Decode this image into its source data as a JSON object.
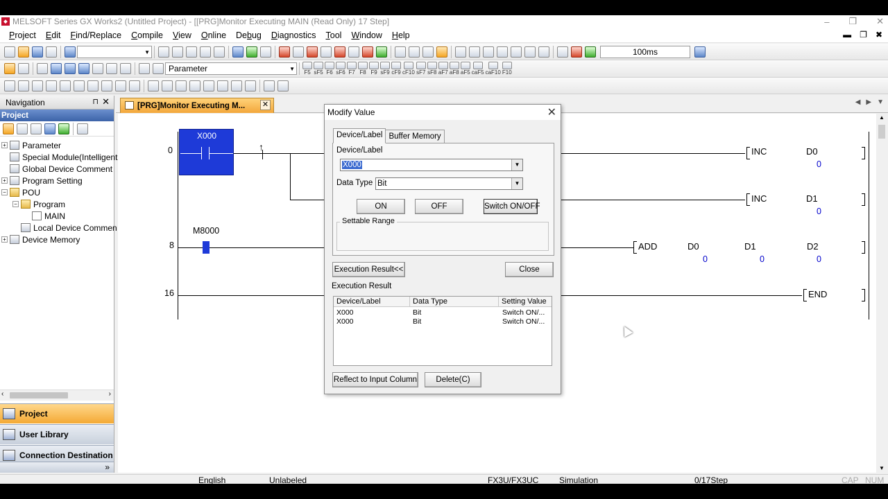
{
  "window": {
    "title": "MELSOFT Series GX Works2 (Untitled Project) - [[PRG]Monitor Executing MAIN (Read Only) 17 Step]",
    "app_icon": "mitsubishi-logo-icon"
  },
  "menu": {
    "items": [
      {
        "pre": "",
        "u": "P",
        "post": "roject"
      },
      {
        "pre": "",
        "u": "E",
        "post": "dit"
      },
      {
        "pre": "",
        "u": "F",
        "post": "ind/Replace"
      },
      {
        "pre": "",
        "u": "C",
        "post": "ompile"
      },
      {
        "pre": "",
        "u": "V",
        "post": "iew"
      },
      {
        "pre": "",
        "u": "O",
        "post": "nline"
      },
      {
        "pre": "De",
        "u": "b",
        "post": "ug"
      },
      {
        "pre": "",
        "u": "D",
        "post": "iagnostics"
      },
      {
        "pre": "",
        "u": "T",
        "post": "ool"
      },
      {
        "pre": "",
        "u": "W",
        "post": "indow"
      },
      {
        "pre": "",
        "u": "H",
        "post": "elp"
      }
    ]
  },
  "toolbar": {
    "parameter_combo": "Parameter",
    "speed": "100ms",
    "fkeys": [
      "F5",
      "sF5",
      "F6",
      "sF6",
      "F7",
      "F8",
      "F9",
      "sF9",
      "cF9",
      "cF10",
      "sF7",
      "sF8",
      "aF7",
      "aF8",
      "aF5",
      "caF5",
      "caF10",
      "F10"
    ]
  },
  "navigation": {
    "header": "Navigation",
    "pin": "⊓",
    "close": "✕",
    "section": "Project",
    "tree": [
      {
        "label": "Parameter",
        "indent": 0,
        "expander": "+",
        "icon": "gear"
      },
      {
        "label": "Special Module(Intelligent",
        "indent": 0,
        "expander": "",
        "icon": "module"
      },
      {
        "label": "Global Device Comment",
        "indent": 0,
        "expander": "",
        "icon": "comment"
      },
      {
        "label": "Program Setting",
        "indent": 0,
        "expander": "+",
        "icon": "gear"
      },
      {
        "label": "POU",
        "indent": 0,
        "expander": "−",
        "icon": "folder"
      },
      {
        "label": "Program",
        "indent": 1,
        "expander": "−",
        "icon": "folder"
      },
      {
        "label": "MAIN",
        "indent": 2,
        "expander": "",
        "icon": "doc"
      },
      {
        "label": "Local Device Commen",
        "indent": 1,
        "expander": "",
        "icon": "comment"
      },
      {
        "label": "Device Memory",
        "indent": 0,
        "expander": "+",
        "icon": "memory"
      }
    ],
    "bottom_buttons": [
      "Project",
      "User Library",
      "Connection Destination"
    ],
    "more": "»"
  },
  "editor": {
    "tab_label": "[PRG]Monitor Executing M...",
    "rungs": [
      {
        "step": "0"
      },
      {
        "step": "8"
      },
      {
        "step": "16"
      }
    ],
    "contact_x000": "X000",
    "contact_m8000": "M8000",
    "instr_inc1": "INC",
    "instr_inc1_dev": "D0",
    "instr_inc1_val": "0",
    "instr_inc2": "INC",
    "instr_inc2_dev": "D1",
    "instr_inc2_val": "0",
    "instr_add": "ADD",
    "add_op1": "D0",
    "add_op1_val": "0",
    "add_op2": "D1",
    "add_op2_val": "0",
    "add_op3": "D2",
    "add_op3_val": "0",
    "instr_end": "END"
  },
  "dialog": {
    "title": "Modify Value",
    "tabs": [
      "Device/Label",
      "Buffer Memory"
    ],
    "device_label": "Device/Label",
    "device_value": "X000",
    "data_type_label": "Data Type",
    "data_type_value": "Bit",
    "btn_on": "ON",
    "btn_off": "OFF",
    "btn_switch": "Switch ON/OFF",
    "settable_range": "Settable Range",
    "btn_exec_result": "Execution Result<<",
    "btn_close": "Close",
    "exec_result_label": "Execution Result",
    "columns": [
      "Device/Label",
      "Data Type",
      "Setting Value"
    ],
    "rows": [
      [
        "X000",
        "Bit",
        "Switch ON/..."
      ],
      [
        "X000",
        "Bit",
        "Switch ON/..."
      ]
    ],
    "btn_reflect": "Reflect to Input Column",
    "btn_delete": "Delete(C)"
  },
  "status": {
    "language": "English",
    "label": "Unlabeled",
    "cpu": "FX3U/FX3UC",
    "connection": "Simulation",
    "steps": "0/17Step",
    "cap": "CAP",
    "num": "NUM"
  }
}
